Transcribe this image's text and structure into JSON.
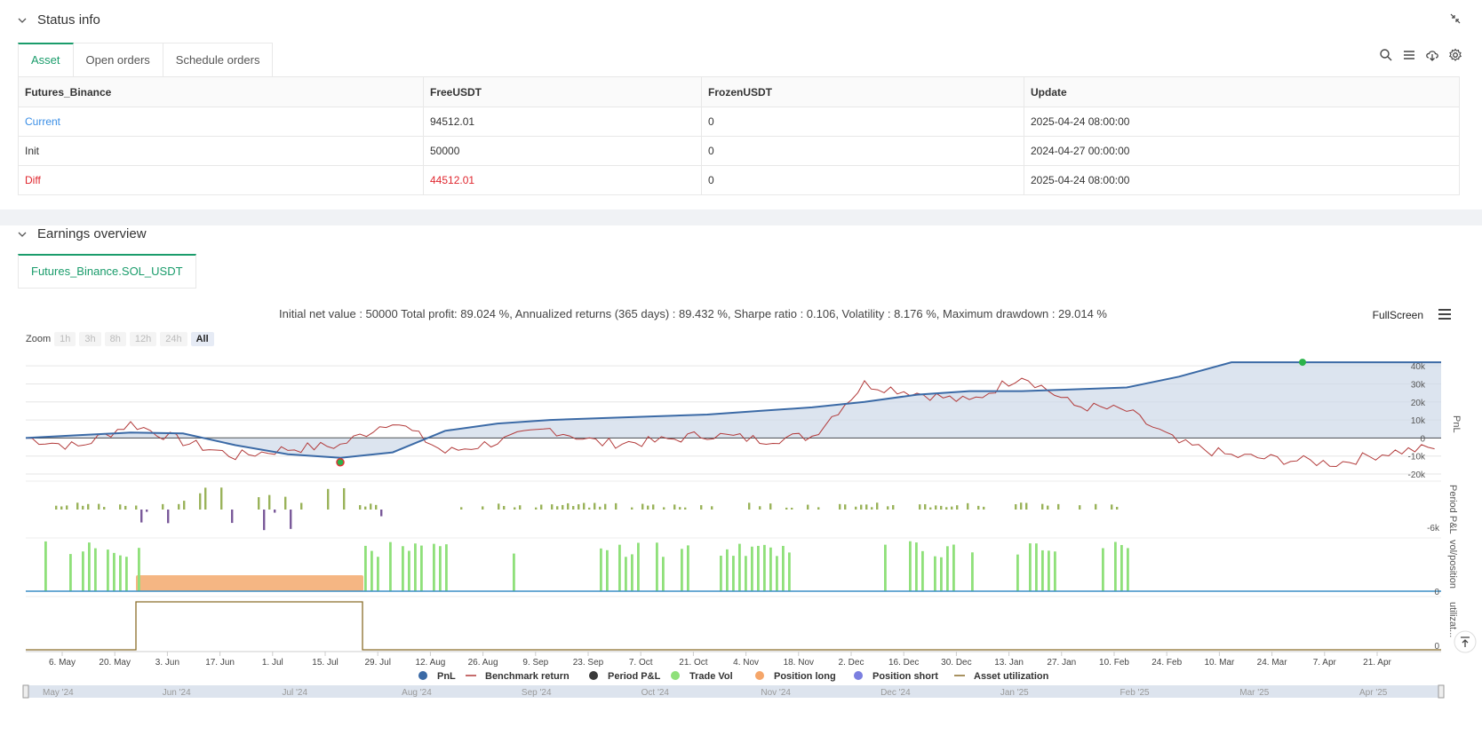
{
  "status": {
    "title": "Status info",
    "tabs": [
      "Asset",
      "Open orders",
      "Schedule orders"
    ],
    "columns": [
      "Futures_Binance",
      "FreeUSDT",
      "FrozenUSDT",
      "Update"
    ],
    "rows": [
      {
        "label": "Current",
        "free": "94512.01",
        "frozen": "0",
        "update": "2025-04-24 08:00:00"
      },
      {
        "label": "Init",
        "free": "50000",
        "frozen": "0",
        "update": "2024-04-27 00:00:00"
      },
      {
        "label": "Diff",
        "free": "44512.01",
        "frozen": "0",
        "update": "2025-04-24 08:00:00"
      }
    ]
  },
  "earnings": {
    "title": "Earnings overview",
    "tab": "Futures_Binance.SOL_USDT",
    "summary": "Initial net value : 50000 Total profit: 89.024 %, Annualized returns (365 days) : 89.432 %, Sharpe ratio : 0.106, Volatility : 8.176 %, Maximum drawdown : 29.014 %",
    "fullscreen": "FullScreen",
    "zoom_label": "Zoom",
    "zoom_buttons": [
      "1h",
      "3h",
      "8h",
      "12h",
      "24h",
      "All"
    ]
  },
  "chart_data": {
    "type": "line",
    "x_ticks": [
      "6. May",
      "20. May",
      "3. Jun",
      "17. Jun",
      "1. Jul",
      "15. Jul",
      "29. Jul",
      "12. Aug",
      "26. Aug",
      "9. Sep",
      "23. Sep",
      "7. Oct",
      "21. Oct",
      "4. Nov",
      "18. Nov",
      "2. Dec",
      "16. Dec",
      "30. Dec",
      "13. Jan",
      "27. Jan",
      "10. Feb",
      "24. Feb",
      "10. Mar",
      "24. Mar",
      "7. Apr",
      "21. Apr"
    ],
    "navigator_ticks": [
      "May '24",
      "Jun '24",
      "Jul '24",
      "Aug '24",
      "Sep '24",
      "Oct '24",
      "Nov '24",
      "Dec '24",
      "Jan '25",
      "Feb '25",
      "Mar '25",
      "Apr '25"
    ],
    "pnl_axis": [
      "40k",
      "30k",
      "20k",
      "10k",
      "0",
      "-10k",
      "-20k"
    ],
    "pnl_ylim": [
      -20000,
      45000
    ],
    "pnl_ylabel": "PnL",
    "period_ylabel": "Period P&L",
    "period_tick": "-6k",
    "vol_ylabel": "vol/position",
    "vol_tick": "0",
    "util_ylabel": "utilizat...",
    "util_tick": "0",
    "legend": [
      {
        "name": "PnL",
        "color": "#3b6aa6"
      },
      {
        "name": "Benchmark return",
        "color": "#b23a3a"
      },
      {
        "name": "Period P&L",
        "color": "#3a3a3a"
      },
      {
        "name": "Trade Vol",
        "color": "#8fe07a"
      },
      {
        "name": "Position long",
        "color": "#f5a66a"
      },
      {
        "name": "Position short",
        "color": "#7b7fe0"
      },
      {
        "name": "Asset utilization",
        "color": "#8a6d2a"
      }
    ],
    "pnl_series": [
      0,
      1500,
      3000,
      2500,
      -4000,
      -9000,
      -11000,
      -8000,
      4000,
      8000,
      10000,
      11000,
      12000,
      13000,
      15000,
      17000,
      20000,
      24000,
      26000,
      26000,
      27000,
      28000,
      34000,
      42000,
      42000,
      42000,
      42000,
      42000
    ],
    "benchmark_series": [
      0,
      -5000,
      8000,
      -2000,
      -10000,
      -6000,
      -4000,
      10000,
      -8000,
      -2000,
      5000,
      -3000,
      -2000,
      2000,
      -1000,
      1000,
      30000,
      25000,
      20000,
      35000,
      18000,
      15000,
      -3000,
      -10000,
      -12000,
      -14000,
      -8000,
      -5000
    ]
  }
}
